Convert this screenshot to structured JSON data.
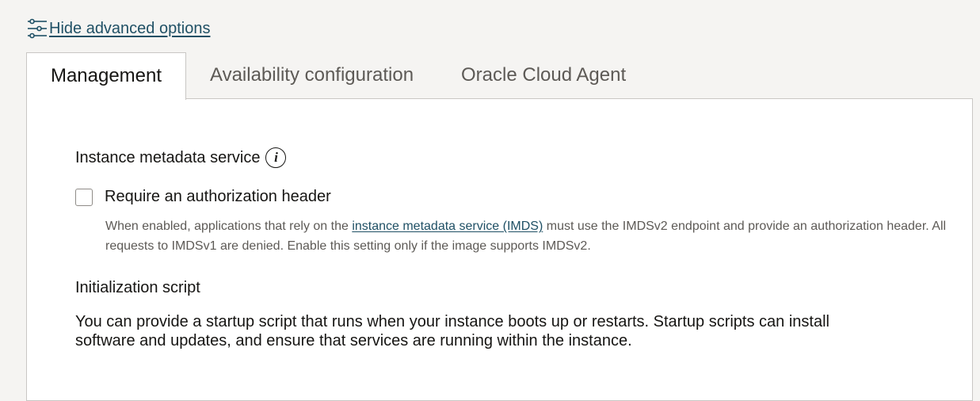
{
  "advanced_toggle": {
    "label": "Hide advanced options",
    "icon": "sliders-icon"
  },
  "tabs": [
    {
      "label": "Management",
      "active": true
    },
    {
      "label": "Availability configuration",
      "active": false
    },
    {
      "label": "Oracle Cloud Agent",
      "active": false
    }
  ],
  "metadata_service": {
    "heading": "Instance metadata service",
    "info_icon": "info-icon",
    "checkbox_label": "Require an authorization header",
    "checked": false,
    "help_prefix": "When enabled, applications that rely on the ",
    "help_link": "instance metadata service (IMDS)",
    "help_suffix": " must use the IMDSv2 endpoint and provide an authorization header. All requests to IMDSv1 are denied. Enable this setting only if the image supports IMDSv2."
  },
  "init_script": {
    "heading": "Initialization script",
    "description": "You can provide a startup script that runs when your instance boots up or restarts. Startup scripts can install software and updates, and ensure that services are running within the instance."
  },
  "colors": {
    "link": "#1f5065",
    "background": "#f5f4f2",
    "panel": "#ffffff",
    "border": "#c9c7c4",
    "muted_text": "#5d5a56"
  }
}
